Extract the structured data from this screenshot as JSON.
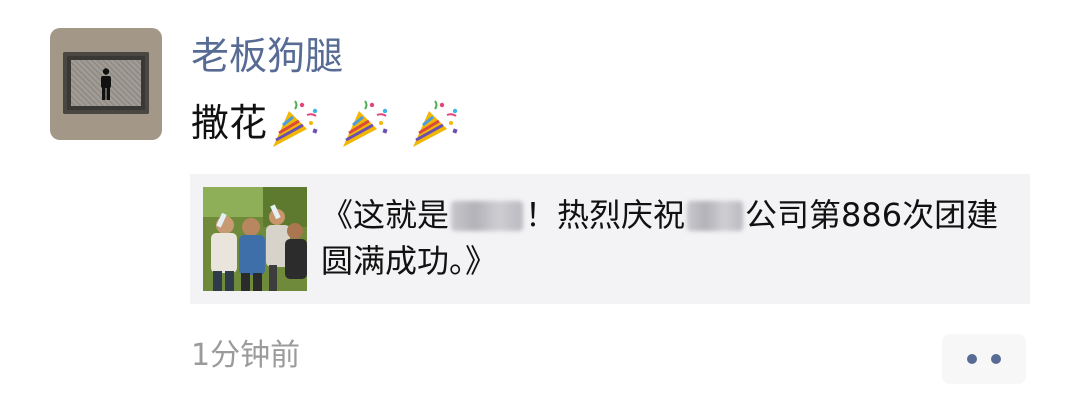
{
  "post": {
    "username": "老板狗腿",
    "message_text": "撒花",
    "message_emojis": [
      "party-popper-emoji",
      "party-popper-emoji",
      "party-popper-emoji"
    ],
    "link_card": {
      "title_part1": "《这就是",
      "title_part2": "！热烈庆祝",
      "title_part3": "公司第886次团建圆满成功。》"
    },
    "timestamp": "1分钟前"
  },
  "colors": {
    "username": "#576b95",
    "timestamp": "#9b9b9b",
    "card_bg": "#f3f3f5",
    "action_dots": "#576b95"
  }
}
